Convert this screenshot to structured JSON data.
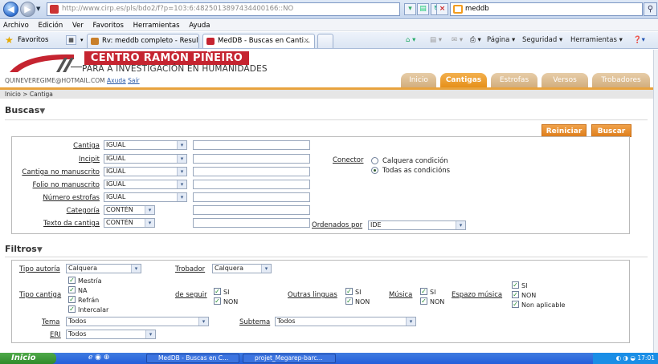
{
  "browser": {
    "url": "http://www.cirp.es/pls/bdo2/f?p=103:6:4825013897434400166::NO",
    "search_value": "meddb",
    "menu": [
      "Archivo",
      "Edición",
      "Ver",
      "Favoritos",
      "Herramientas",
      "Ayuda"
    ],
    "favorites_label": "Favoritos",
    "tabs": [
      "Rv: meddb completo - Result...",
      "MedDB - Buscas en Canti..."
    ],
    "commands": [
      "Página ▾",
      "Seguridad ▾",
      "Herramientas ▾"
    ]
  },
  "site": {
    "title": "CENTRO RAMÓN PIÑEIRO",
    "subtitle": "PARA A INVESTIGACIÓN EN HUMANIDADES",
    "user_email": "QUINEVEREGIME@HOTMAIL.COM",
    "help_link": "Axuda",
    "logout_link": "Saír",
    "tabs": [
      "Inicio",
      "Cantigas",
      "Estrofas",
      "Versos",
      "Trobadores"
    ],
    "breadcrumb": "Inicio > Cantiga"
  },
  "buscas": {
    "title": "Buscas",
    "reset_label": "Reiniciar",
    "search_label": "Buscar",
    "rows": [
      {
        "label": "Cantiga",
        "op": "IGUAL",
        "value": ""
      },
      {
        "label": "Incipit",
        "op": "IGUAL",
        "value": ""
      },
      {
        "label": "Cantiga no manuscrito",
        "op": "IGUAL",
        "value": ""
      },
      {
        "label": "Folio no manuscrito",
        "op": "IGUAL",
        "value": ""
      },
      {
        "label": "Número estrofas",
        "op": "IGUAL",
        "value": ""
      },
      {
        "label": "Categoría",
        "op": "CONTÉN",
        "value": ""
      },
      {
        "label": "Texto da cantiga",
        "op": "CONTÉN",
        "value": ""
      }
    ],
    "connector_label": "Conector",
    "connector_options": [
      "Calquera condición",
      "Todas as condicións"
    ],
    "connector_selected": "Todas as condicións",
    "order_label": "Ordenados por",
    "order_value": "IDE"
  },
  "filtros": {
    "title": "Filtros",
    "tipo_autoria_label": "Tipo autoría",
    "tipo_autoria_value": "Calquera",
    "trobador_label": "Trobador",
    "trobador_value": "Calquera",
    "tipo_cantiga_label": "Tipo cantiga",
    "tipo_cantiga_options": [
      "Mestría",
      "NA",
      "Refrán",
      "Intercalar"
    ],
    "de_seguir_label": "de seguir",
    "outras_linguas_label": "Outras linguas",
    "musica_label": "Música",
    "espazo_musica_label": "Espazo música",
    "si_label": "SI",
    "non_label": "NON",
    "non_aplicable_label": "Non aplicable",
    "tema_label": "Tema",
    "tema_value": "Todos",
    "subtema_label": "Subtema",
    "subtema_value": "Todos",
    "eri_label": "ERI",
    "eri_value": "Todos"
  },
  "taskbar": {
    "start_label": "Inicio",
    "tasks": [
      "MedDB - Buscas en C...",
      "projet_Megarep-barc..."
    ],
    "clock": "17:01"
  },
  "colors": {
    "brand_red": "#c52430",
    "tab_orange": "#e6901a",
    "button_orange": "#de7e1c"
  }
}
